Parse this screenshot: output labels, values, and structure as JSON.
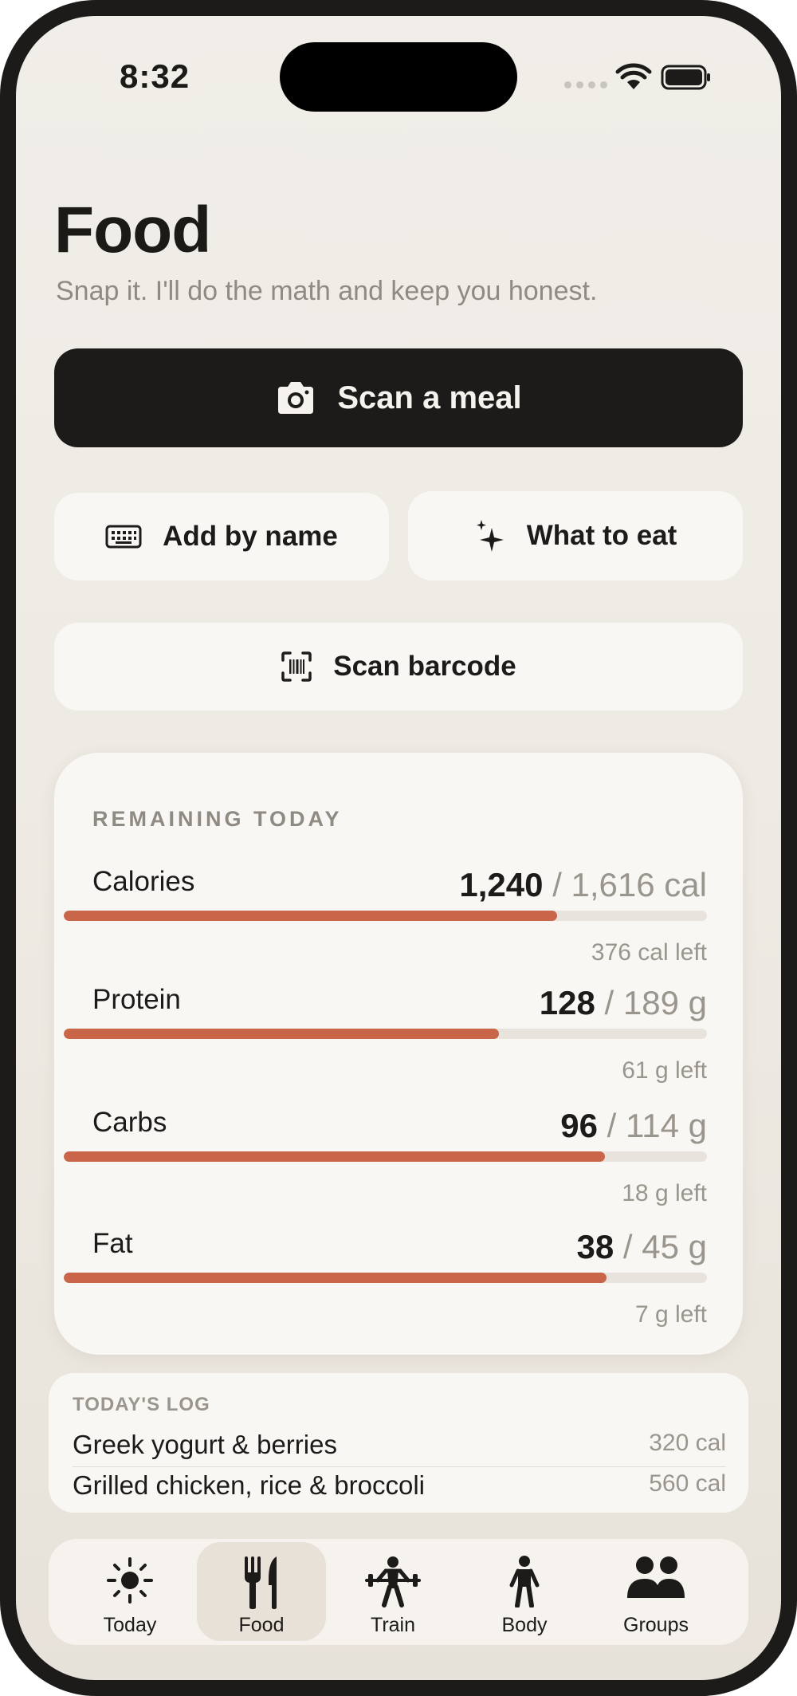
{
  "status_bar": {
    "time": "8:32",
    "icons": [
      "signal-dots-icon",
      "wifi-icon",
      "battery-icon"
    ]
  },
  "header": {
    "title": "Food",
    "subtitle": "Snap it. I'll do the math and keep you honest."
  },
  "actions": {
    "scan_meal": {
      "label": "Scan a meal",
      "icon": "camera-icon"
    },
    "add_by_name": {
      "label": "Add by name",
      "icon": "keyboard-icon"
    },
    "what_to_eat": {
      "label": "What to eat",
      "icon": "sparkle-icon"
    },
    "scan_barcode": {
      "label": "Scan barcode",
      "icon": "barcode-scan-icon"
    }
  },
  "remaining": {
    "heading": "REMAINING TODAY",
    "macros": [
      {
        "label": "Calories",
        "value": "1,240",
        "target": "/ 1,616 cal",
        "left": "376 cal left",
        "progress": 0.767
      },
      {
        "label": "Protein",
        "value": "128",
        "target": "/ 189 g",
        "left": "61 g left",
        "progress": 0.677
      },
      {
        "label": "Carbs",
        "value": "96",
        "target": "/ 114 g",
        "left": "18 g left",
        "progress": 0.842
      },
      {
        "label": "Fat",
        "value": "38",
        "target": "/ 45 g",
        "left": "7 g left",
        "progress": 0.844
      }
    ]
  },
  "log": {
    "heading": "TODAY'S LOG",
    "items": [
      {
        "name": "Greek yogurt & berries",
        "cal": "320 cal"
      },
      {
        "name": "Grilled chicken, rice & broccoli",
        "cal": "560 cal"
      }
    ]
  },
  "tabbar": {
    "active": "Food",
    "tabs": [
      {
        "label": "Today",
        "icon": "sun-icon"
      },
      {
        "label": "Food",
        "icon": "fork-knife-icon"
      },
      {
        "label": "Train",
        "icon": "weightlifter-icon"
      },
      {
        "label": "Body",
        "icon": "person-icon"
      },
      {
        "label": "Groups",
        "icon": "group-icon"
      }
    ]
  },
  "colors": {
    "background": "#efebe5",
    "card": "#f9f7f3",
    "primary_button": "#1d1b19",
    "accent_bar": "#c9664a",
    "track": "#e8e3dc",
    "muted_text": "#9a958d"
  }
}
